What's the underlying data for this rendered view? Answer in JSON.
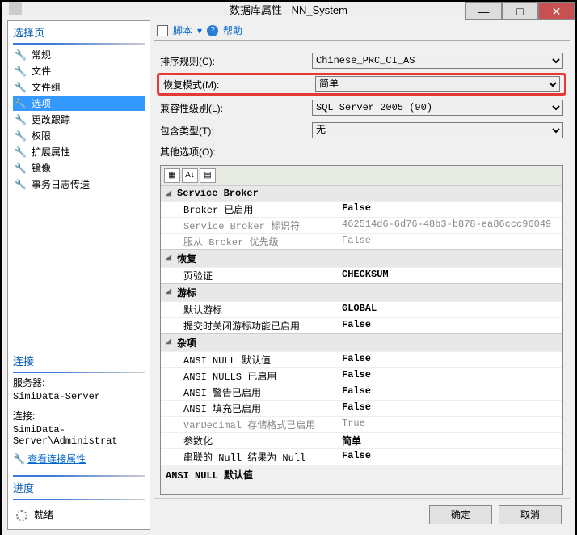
{
  "window": {
    "title": "数据库属性 - NN_System"
  },
  "sidebar": {
    "select_header": "选择页",
    "items": [
      {
        "label": "常规"
      },
      {
        "label": "文件"
      },
      {
        "label": "文件组"
      },
      {
        "label": "选项",
        "selected": true
      },
      {
        "label": "更改跟踪"
      },
      {
        "label": "权限"
      },
      {
        "label": "扩展属性"
      },
      {
        "label": "镜像"
      },
      {
        "label": "事务日志传送"
      }
    ],
    "connect_header": "连接",
    "server_label": "服务器:",
    "server_value": "SimiData-Server",
    "conn_label": "连接:",
    "conn_value": "SimiData-Server\\Administrat",
    "view_link": "查看连接属性",
    "progress_header": "进度",
    "progress_label": "就绪"
  },
  "toolbar": {
    "script": "脚本",
    "help": "帮助"
  },
  "form": {
    "collation": {
      "label": "排序规则(C):",
      "value": "Chinese_PRC_CI_AS"
    },
    "recovery": {
      "label": "恢复模式(M):",
      "value": "简单"
    },
    "compat": {
      "label": "兼容性级别(L):",
      "value": "SQL Server 2005 (90)"
    },
    "containment": {
      "label": "包含类型(T):",
      "value": "无"
    },
    "other_label": "其他选项(O):"
  },
  "grid": {
    "sections": [
      {
        "header": "Service Broker",
        "rows": [
          {
            "name": "Broker 已启用",
            "value": "False",
            "bold": true
          },
          {
            "name": "Service Broker 标识符",
            "value": "462514d6-6d76-48b3-b878-ea86ccc96049",
            "disabled": true
          },
          {
            "name": "服从 Broker 优先级",
            "value": "False",
            "disabled": true
          }
        ]
      },
      {
        "header": "恢复",
        "rows": [
          {
            "name": "页验证",
            "value": "CHECKSUM",
            "bold": true
          }
        ]
      },
      {
        "header": "游标",
        "rows": [
          {
            "name": "默认游标",
            "value": "GLOBAL",
            "bold": true
          },
          {
            "name": "提交时关闭游标功能已启用",
            "value": "False",
            "bold": true
          }
        ]
      },
      {
        "header": "杂项",
        "rows": [
          {
            "name": "ANSI NULL 默认值",
            "value": "False",
            "bold": true
          },
          {
            "name": "ANSI NULLS 已启用",
            "value": "False",
            "bold": true
          },
          {
            "name": "ANSI 警告已启用",
            "value": "False",
            "bold": true
          },
          {
            "name": "ANSI 填充已启用",
            "value": "False",
            "bold": true
          },
          {
            "name": "VarDecimal 存储格式已启用",
            "value": "True",
            "disabled": true
          },
          {
            "name": "参数化",
            "value": "简单",
            "bold": true
          },
          {
            "name": "串联的 Null 结果为 Null",
            "value": "False",
            "bold": true
          }
        ]
      }
    ],
    "desc": "ANSI NULL 默认值"
  },
  "footer": {
    "ok": "确定",
    "cancel": "取消"
  }
}
